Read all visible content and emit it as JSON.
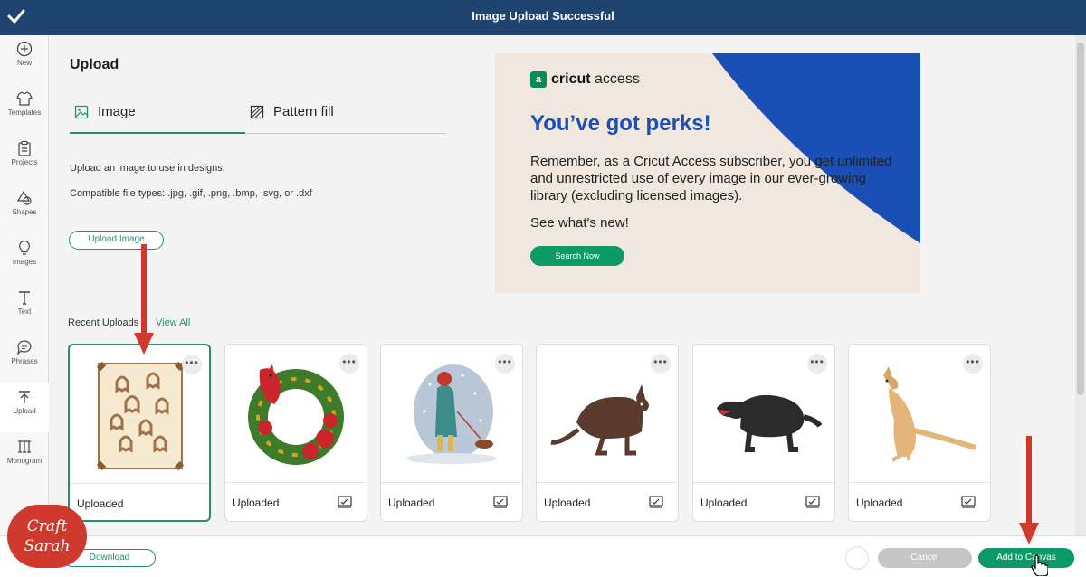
{
  "topbar": {
    "title": "Image Upload Successful"
  },
  "sidebar": {
    "items": [
      {
        "label": "New",
        "icon": "plus-circle-icon"
      },
      {
        "label": "Templates",
        "icon": "shirt-icon"
      },
      {
        "label": "Projects",
        "icon": "clipboard-icon"
      },
      {
        "label": "Shapes",
        "icon": "shapes-icon"
      },
      {
        "label": "Images",
        "icon": "lightbulb-icon"
      },
      {
        "label": "Text",
        "icon": "text-icon"
      },
      {
        "label": "Phrases",
        "icon": "speech-bubble-icon"
      },
      {
        "label": "Upload",
        "icon": "upload-icon"
      },
      {
        "label": "Monogram",
        "icon": "monogram-icon"
      }
    ]
  },
  "main": {
    "heading": "Upload",
    "tabs": [
      {
        "label": "Image",
        "icon": "image-icon",
        "active": true
      },
      {
        "label": "Pattern fill",
        "icon": "pattern-icon",
        "active": false
      }
    ],
    "description": "Upload an image to use in designs.",
    "file_types": "Compatible file types: .jpg, .gif, .png, .bmp, .svg, or .dxf",
    "upload_button": "Upload Image",
    "recent_label": "Recent Uploads",
    "view_all": "View All"
  },
  "banner": {
    "logo_brand": "cricut",
    "logo_suffix": "access",
    "logo_badge": "a",
    "headline": "You’ve got perks!",
    "body": "Remember, as a Cricut Access subscriber, you get unlimited and unrestricted use of every image in our ever-growing library (excluding licensed images).",
    "new_text": "See what's new!",
    "cta": "Search Now",
    "colors": {
      "blue": "#1a4fb5",
      "cream": "#f1e7df",
      "green": "#0e9a66"
    }
  },
  "uploads": [
    {
      "caption": "Uploaded",
      "subject": "ghost cookies"
    },
    {
      "caption": "Uploaded",
      "subject": "cardinal wreath"
    },
    {
      "caption": "Uploaded",
      "subject": "winter walker with dog"
    },
    {
      "caption": "Uploaded",
      "subject": "wallaby"
    },
    {
      "caption": "Uploaded",
      "subject": "tasmanian devil"
    },
    {
      "caption": "Uploaded",
      "subject": "kangaroo"
    }
  ],
  "footer": {
    "download": "Download",
    "cancel": "Cancel",
    "add": "Add to Canvas"
  },
  "watermark": {
    "line1": "Craft",
    "line2": "Sarah",
    "small": "WITH"
  },
  "colors": {
    "accent": "#2a8c72",
    "topbar": "#1f4470",
    "arrow": "#d03a2e"
  }
}
